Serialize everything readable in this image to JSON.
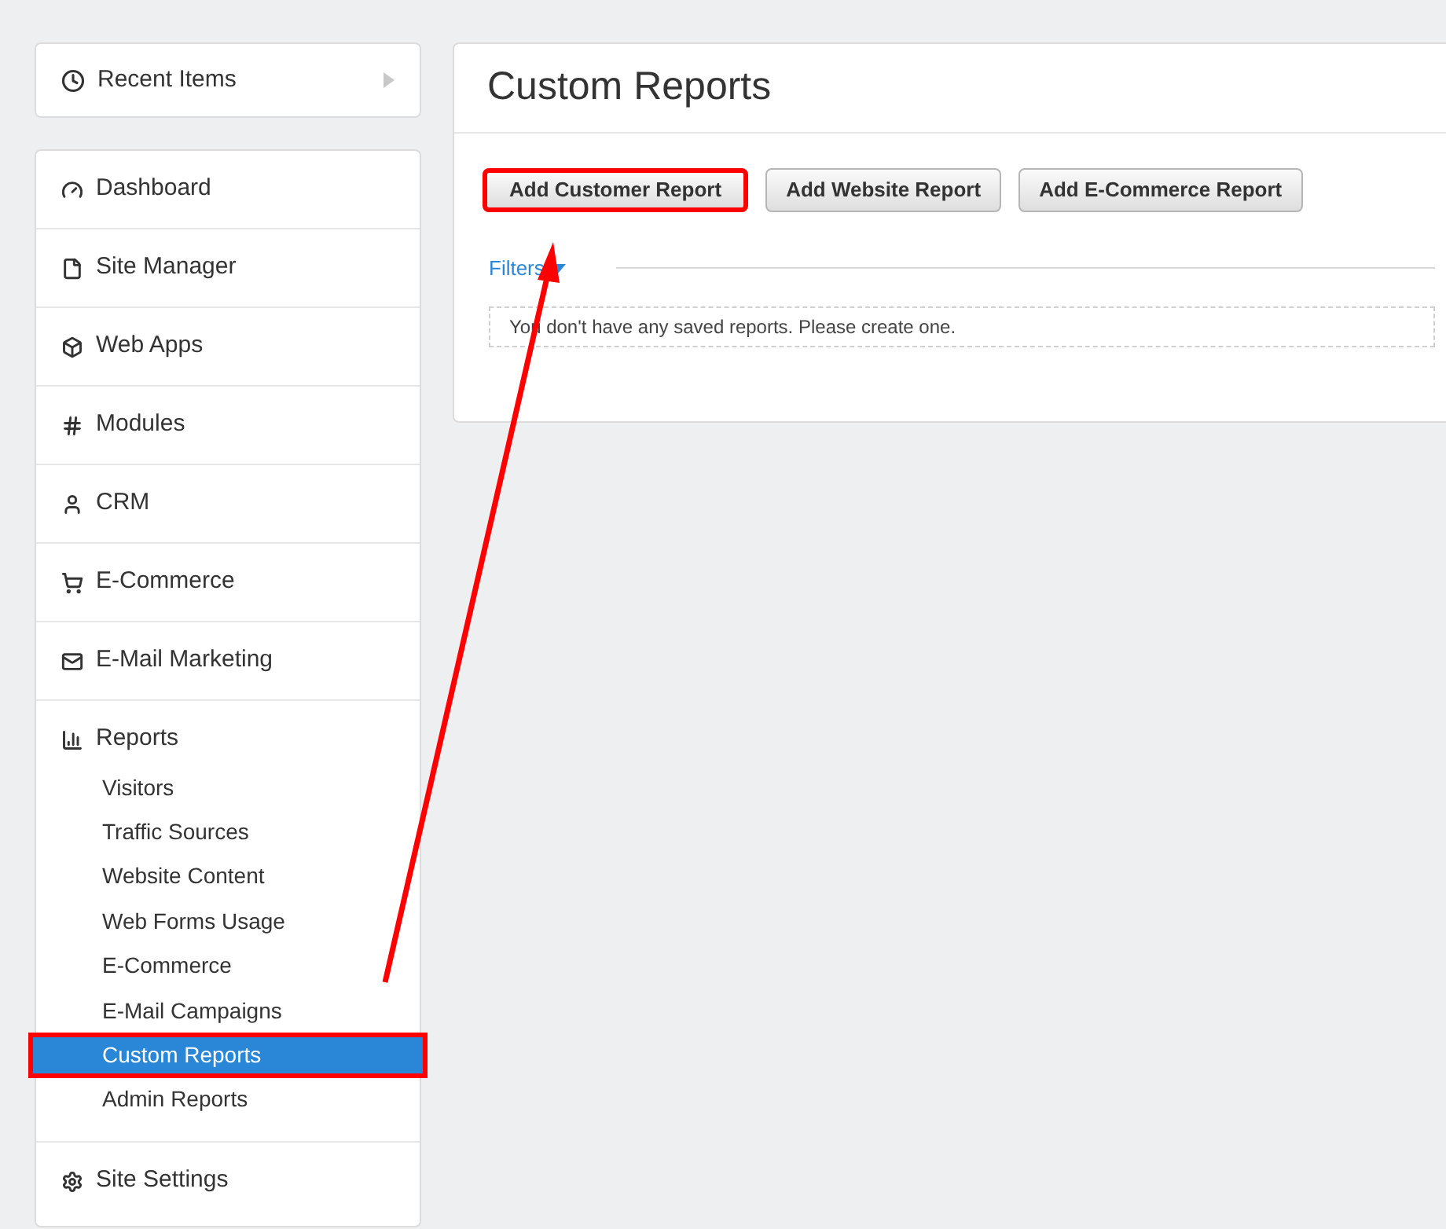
{
  "recent": {
    "label": "Recent Items"
  },
  "nav": [
    {
      "kind": "section",
      "label": "Dashboard"
    },
    {
      "kind": "section",
      "label": "Site Manager"
    },
    {
      "kind": "section",
      "label": "Web Apps"
    },
    {
      "kind": "section",
      "label": "Modules"
    },
    {
      "kind": "section",
      "label": "CRM"
    },
    {
      "kind": "section",
      "label": "E-Commerce"
    },
    {
      "kind": "section",
      "label": "E-Mail Marketing"
    },
    {
      "kind": "section",
      "label": "Reports",
      "children": [
        {
          "label": "Visitors",
          "selected": false,
          "highlighted": false
        },
        {
          "label": "Traffic Sources",
          "selected": false,
          "highlighted": false
        },
        {
          "label": "Website Content",
          "selected": false,
          "highlighted": false
        },
        {
          "label": "Web Forms Usage",
          "selected": false,
          "highlighted": false
        },
        {
          "label": "E-Commerce",
          "selected": false,
          "highlighted": false
        },
        {
          "label": "E-Mail Campaigns",
          "selected": false,
          "highlighted": false
        },
        {
          "label": "Custom Reports",
          "selected": true,
          "highlighted": true
        },
        {
          "label": "Admin Reports",
          "selected": false,
          "highlighted": false
        }
      ]
    },
    {
      "kind": "section",
      "label": "Site Settings"
    }
  ],
  "page": {
    "title": "Custom Reports",
    "buttons": [
      {
        "label": "Add Customer Report",
        "highlighted": true
      },
      {
        "label": "Add Website Report",
        "highlighted": false
      },
      {
        "label": "Add E-Commerce Report",
        "highlighted": false
      }
    ],
    "filter": "Filters",
    "empty_message": "You don't have any saved reports. Please create one."
  }
}
